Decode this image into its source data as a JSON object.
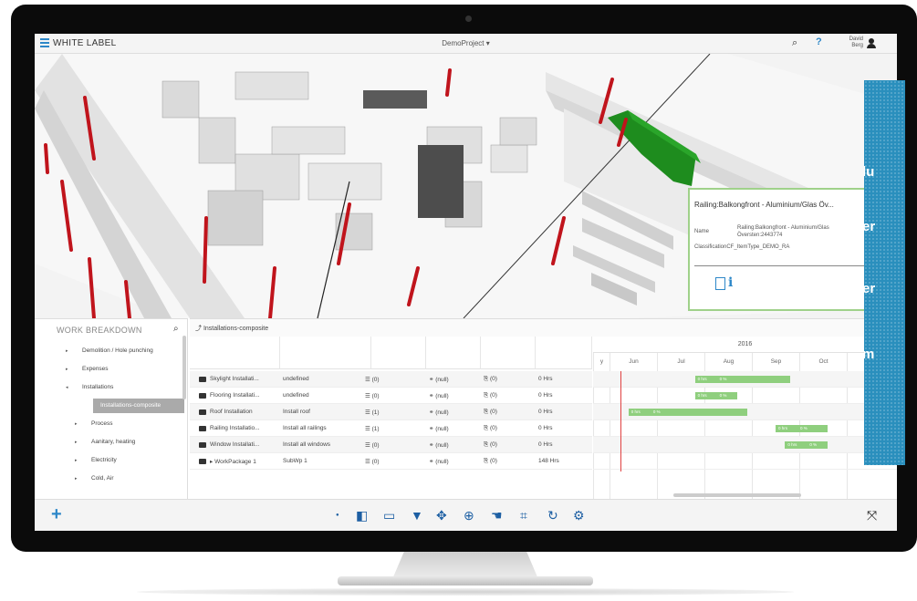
{
  "header": {
    "brand": "WHITE LABEL",
    "project": "DemoProject ▾",
    "search_icon": "⌕",
    "help": "?",
    "user": "David Berg"
  },
  "popup": {
    "title": "Railing:Balkongfront - Aluminium/Glas Öv...",
    "name_label": "Name",
    "name_value": "Railing:Balkongfront - Aluminium/Glas Översten:2443774",
    "classification": "ClassificationCF_ItemType_DEMO_RA",
    "info": "i"
  },
  "teal_fragments": [
    "lu",
    "er",
    "er",
    "m"
  ],
  "work_breakdown": {
    "title": "WORK BREAKDOWN",
    "items": [
      {
        "label": "Demolition / Hole punching",
        "caret": "▸"
      },
      {
        "label": "Expenses",
        "caret": "▸"
      },
      {
        "label": "Installations",
        "caret": "◂"
      },
      {
        "label": "Installations-composite",
        "caret": ""
      },
      {
        "label": "Process",
        "caret": "▸"
      },
      {
        "label": "Aanitary, heating",
        "caret": "▸"
      },
      {
        "label": "Electricity",
        "caret": "▸"
      },
      {
        "label": "Cold, Air",
        "caret": "▸"
      }
    ]
  },
  "table": {
    "title": "⤴ Installations-composite",
    "rows": [
      {
        "name": "Skylight Installati...",
        "desc": "undefined",
        "list": "☰ (0)",
        "res": "⚭ (null)",
        "att": "⎘ (0)",
        "hrs": "0 Hrs"
      },
      {
        "name": "Flooring Installati...",
        "desc": "undefined",
        "list": "☰ (0)",
        "res": "⚭ (null)",
        "att": "⎘ (0)",
        "hrs": "0 Hrs"
      },
      {
        "name": "Roof Installation",
        "desc": "Install roof",
        "list": "☰ (1)",
        "res": "⚭ (null)",
        "att": "⎘ (0)",
        "hrs": "0 Hrs"
      },
      {
        "name": "Railing Installatio...",
        "desc": "Install all railings",
        "list": "☰ (1)",
        "res": "⚭ (null)",
        "att": "⎘ (0)",
        "hrs": "0 Hrs"
      },
      {
        "name": "Window Installati...",
        "desc": "Install all windows",
        "list": "☰ (0)",
        "res": "⚭ (null)",
        "att": "⎘ (0)",
        "hrs": "0 Hrs"
      },
      {
        "name": "▸ WorkPackage 1",
        "desc": "SubWp 1",
        "list": "☰ (0)",
        "res": "⚭ (null)",
        "att": "⎘ (0)",
        "hrs": "148 Hrs"
      }
    ]
  },
  "gantt": {
    "year": "2016",
    "months": [
      "y",
      "Jun",
      "Jul",
      "Aug",
      "Sep",
      "Oct",
      "Nov"
    ],
    "bars": [
      {
        "row": 0,
        "start": 2.8,
        "end": 4.8,
        "labels": [
          "0 hrs",
          "0 %"
        ]
      },
      {
        "row": 1,
        "start": 2.8,
        "end": 3.7,
        "labels": [
          "0 hrs",
          "0 %"
        ]
      },
      {
        "row": 2,
        "start": 1.4,
        "end": 3.9,
        "labels": [
          "0 hrs",
          "0 %"
        ]
      },
      {
        "row": 3,
        "start": 4.5,
        "end": 5.6,
        "labels": [
          "0 hrs",
          "0 %"
        ]
      },
      {
        "row": 4,
        "start": 4.7,
        "end": 5.6,
        "labels": [
          "0 hrs",
          "0 %"
        ]
      }
    ]
  },
  "toolbar": {
    "add": "+",
    "buttons": [
      "●",
      "◧",
      "▭",
      "▼",
      "✥",
      "⊕",
      "☚",
      "⌗",
      "↻",
      "⚙"
    ],
    "expand": "⤧"
  },
  "colors": {
    "accent": "#2d87c8",
    "bar": "#8fcf7e",
    "highlight": "#1e8c1e",
    "post": "#c0141c",
    "teal": "#2a8fbd"
  }
}
